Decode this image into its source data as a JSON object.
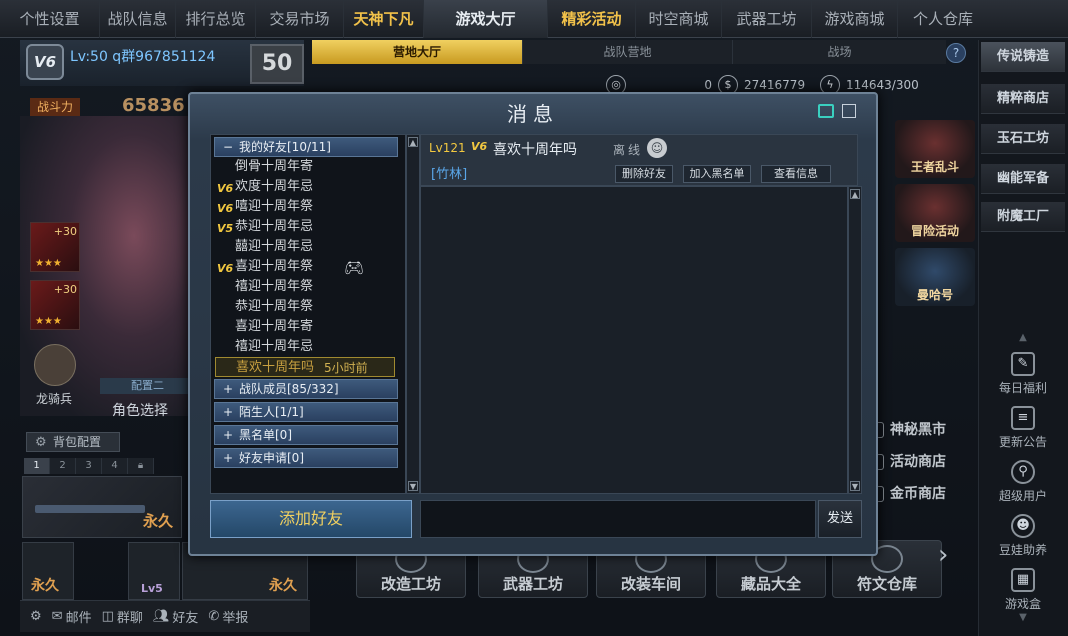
{
  "topnav": [
    "个性设置",
    "战队信息",
    "排行总览",
    "交易市场",
    "天神下凡",
    "游戏大厅",
    "精彩活动",
    "时空商城",
    "武器工坊",
    "游戏商城",
    "个人仓库"
  ],
  "player": {
    "badge": "V6",
    "level_text": "Lv:50 q群967851124",
    "level_badge": "50",
    "power_label": "战斗力",
    "power_value": "65836",
    "slot_plus": "+30",
    "slot_stars": "★★★",
    "rider_label": "龙骑兵",
    "config_label": "配置二",
    "role_select": "角色选择",
    "bag_config": "背包配置",
    "slot_tabs": [
      "1",
      "2",
      "3",
      "4"
    ],
    "permanent": "永久",
    "lv5": "Lv5",
    "bottom": {
      "mail": "邮件",
      "group": "群聊",
      "friends": "好友",
      "report": "举报"
    }
  },
  "main_tabs": [
    "营地大厅",
    "战队营地",
    "战场"
  ],
  "help": "?",
  "currency": {
    "a": "0",
    "b": "27416779",
    "c": "114643/300"
  },
  "right_tabs": [
    "传说铸造",
    "精粹商店",
    "玉石工坊",
    "幽能军备",
    "附魔工厂"
  ],
  "right_icons": [
    "每日福利",
    "更新公告",
    "超级用户",
    "豆娃助养",
    "游戏盒"
  ],
  "promos": [
    "王者乱斗",
    "冒险活动",
    "曼哈号"
  ],
  "shop_links": [
    "神秘黑市",
    "活动商店",
    "金币商店"
  ],
  "bottom_buttons": [
    "改造工坊",
    "武器工坊",
    "改装车间",
    "藏品大全",
    "符文仓库"
  ],
  "dialog": {
    "title": "消息",
    "groups": [
      {
        "sign": "−",
        "label": "我的好友[10/11]"
      },
      {
        "sign": "+",
        "label": "战队成员[85/332]"
      },
      {
        "sign": "+",
        "label": "陌生人[1/1]"
      },
      {
        "sign": "+",
        "label": "黑名单[0]"
      },
      {
        "sign": "+",
        "label": "好友申请[0]"
      }
    ],
    "friends": [
      {
        "vip": "",
        "name": "倒骨十周年寄"
      },
      {
        "vip": "V6",
        "name": "欢度十周年忌"
      },
      {
        "vip": "V6",
        "name": "嘻迎十周年祭"
      },
      {
        "vip": "V5",
        "name": "恭迎十周年忌"
      },
      {
        "vip": "",
        "name": "囍迎十周年忌"
      },
      {
        "vip": "V6",
        "name": "喜迎十周年祭"
      },
      {
        "vip": "",
        "name": "禧迎十周年祭"
      },
      {
        "vip": "",
        "name": "恭迎十周年祭"
      },
      {
        "vip": "",
        "name": "喜迎十周年寄"
      },
      {
        "vip": "",
        "name": "禧迎十周年忌"
      },
      {
        "vip": "",
        "name": "喜欢十周年吗",
        "ago": "5小时前"
      }
    ],
    "chat": {
      "level": "Lv121",
      "vip": "V6",
      "name": "喜欢十周年吗",
      "status": "离线",
      "guild": "[竹林]",
      "buttons": [
        "删除好友",
        "加入黑名单",
        "查看信息"
      ]
    },
    "add_friend": "添加好友",
    "input_value": "",
    "send": "发送"
  }
}
